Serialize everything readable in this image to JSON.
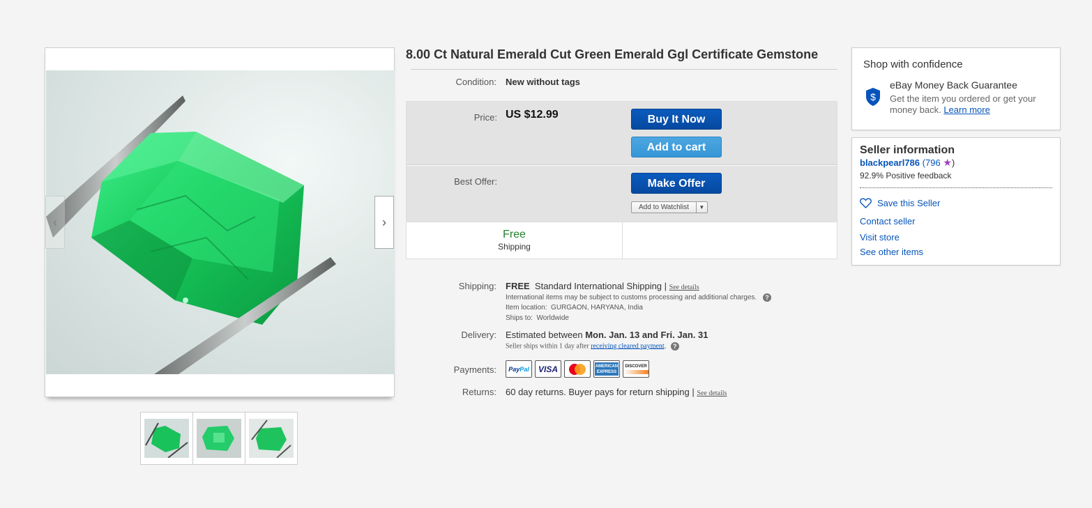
{
  "image_panel": {
    "prev_icon": "chevron-left-icon",
    "next_icon": "chevron-right-icon",
    "thumbnail_count": 3
  },
  "item": {
    "title": "8.00 Ct Natural Emerald Cut Green Emerald Ggl Certificate Gemstone",
    "condition_label": "Condition:",
    "condition_value": "New without tags",
    "price_label": "Price:",
    "price_value": "US $12.99",
    "best_offer_label": "Best Offer:",
    "buy_it_now": "Buy It Now",
    "add_to_cart": "Add to cart",
    "make_offer": "Make Offer",
    "add_to_watchlist": "Add to Watchlist",
    "free_label": "Free",
    "shipping_label": "Shipping"
  },
  "shipping": {
    "label": "Shipping:",
    "free": "FREE",
    "service": "Standard International Shipping |",
    "see_details": "See details",
    "customs_note": "International items may be subject to customs processing and additional charges.",
    "item_location_label": "Item location:",
    "item_location": "GURGAON, HARYANA, India",
    "ships_to_label": "Ships to:",
    "ships_to": "Worldwide"
  },
  "delivery": {
    "label": "Delivery:",
    "estimated_prefix": "Estimated between",
    "dates": "Mon. Jan. 13 and Fri. Jan. 31",
    "seller_ships_prefix": "Seller ships within 1 day after",
    "seller_ships_link": "receiving cleared payment",
    "seller_ships_suffix": "."
  },
  "payments": {
    "label": "Payments:",
    "methods": [
      "PayPal",
      "VISA",
      "Mastercard",
      "American Express",
      "DISCOVER"
    ]
  },
  "returns": {
    "label": "Returns:",
    "text": "60 day returns. Buyer pays for return shipping |",
    "see_details": "See details"
  },
  "confidence": {
    "title": "Shop with confidence",
    "guarantee_title": "eBay Money Back Guarantee",
    "guarantee_text": "Get the item you ordered or get your money back.",
    "learn_more": "Learn more",
    "shield_icon": "dollar-shield-icon"
  },
  "seller": {
    "title": "Seller information",
    "name": "blackpearl786",
    "feedback_open": "(",
    "feedback_count": "796",
    "feedback_close": ")",
    "positive": "92.9% Positive feedback",
    "save_seller": "Save this Seller",
    "contact": "Contact seller",
    "visit_store": "Visit store",
    "other_items": "See other items"
  },
  "colors": {
    "primary_button": "#0654ba",
    "secondary_button": "#3e9de0",
    "link": "#0654ba",
    "free_green": "#24812f",
    "emerald": "#1ec85a"
  }
}
